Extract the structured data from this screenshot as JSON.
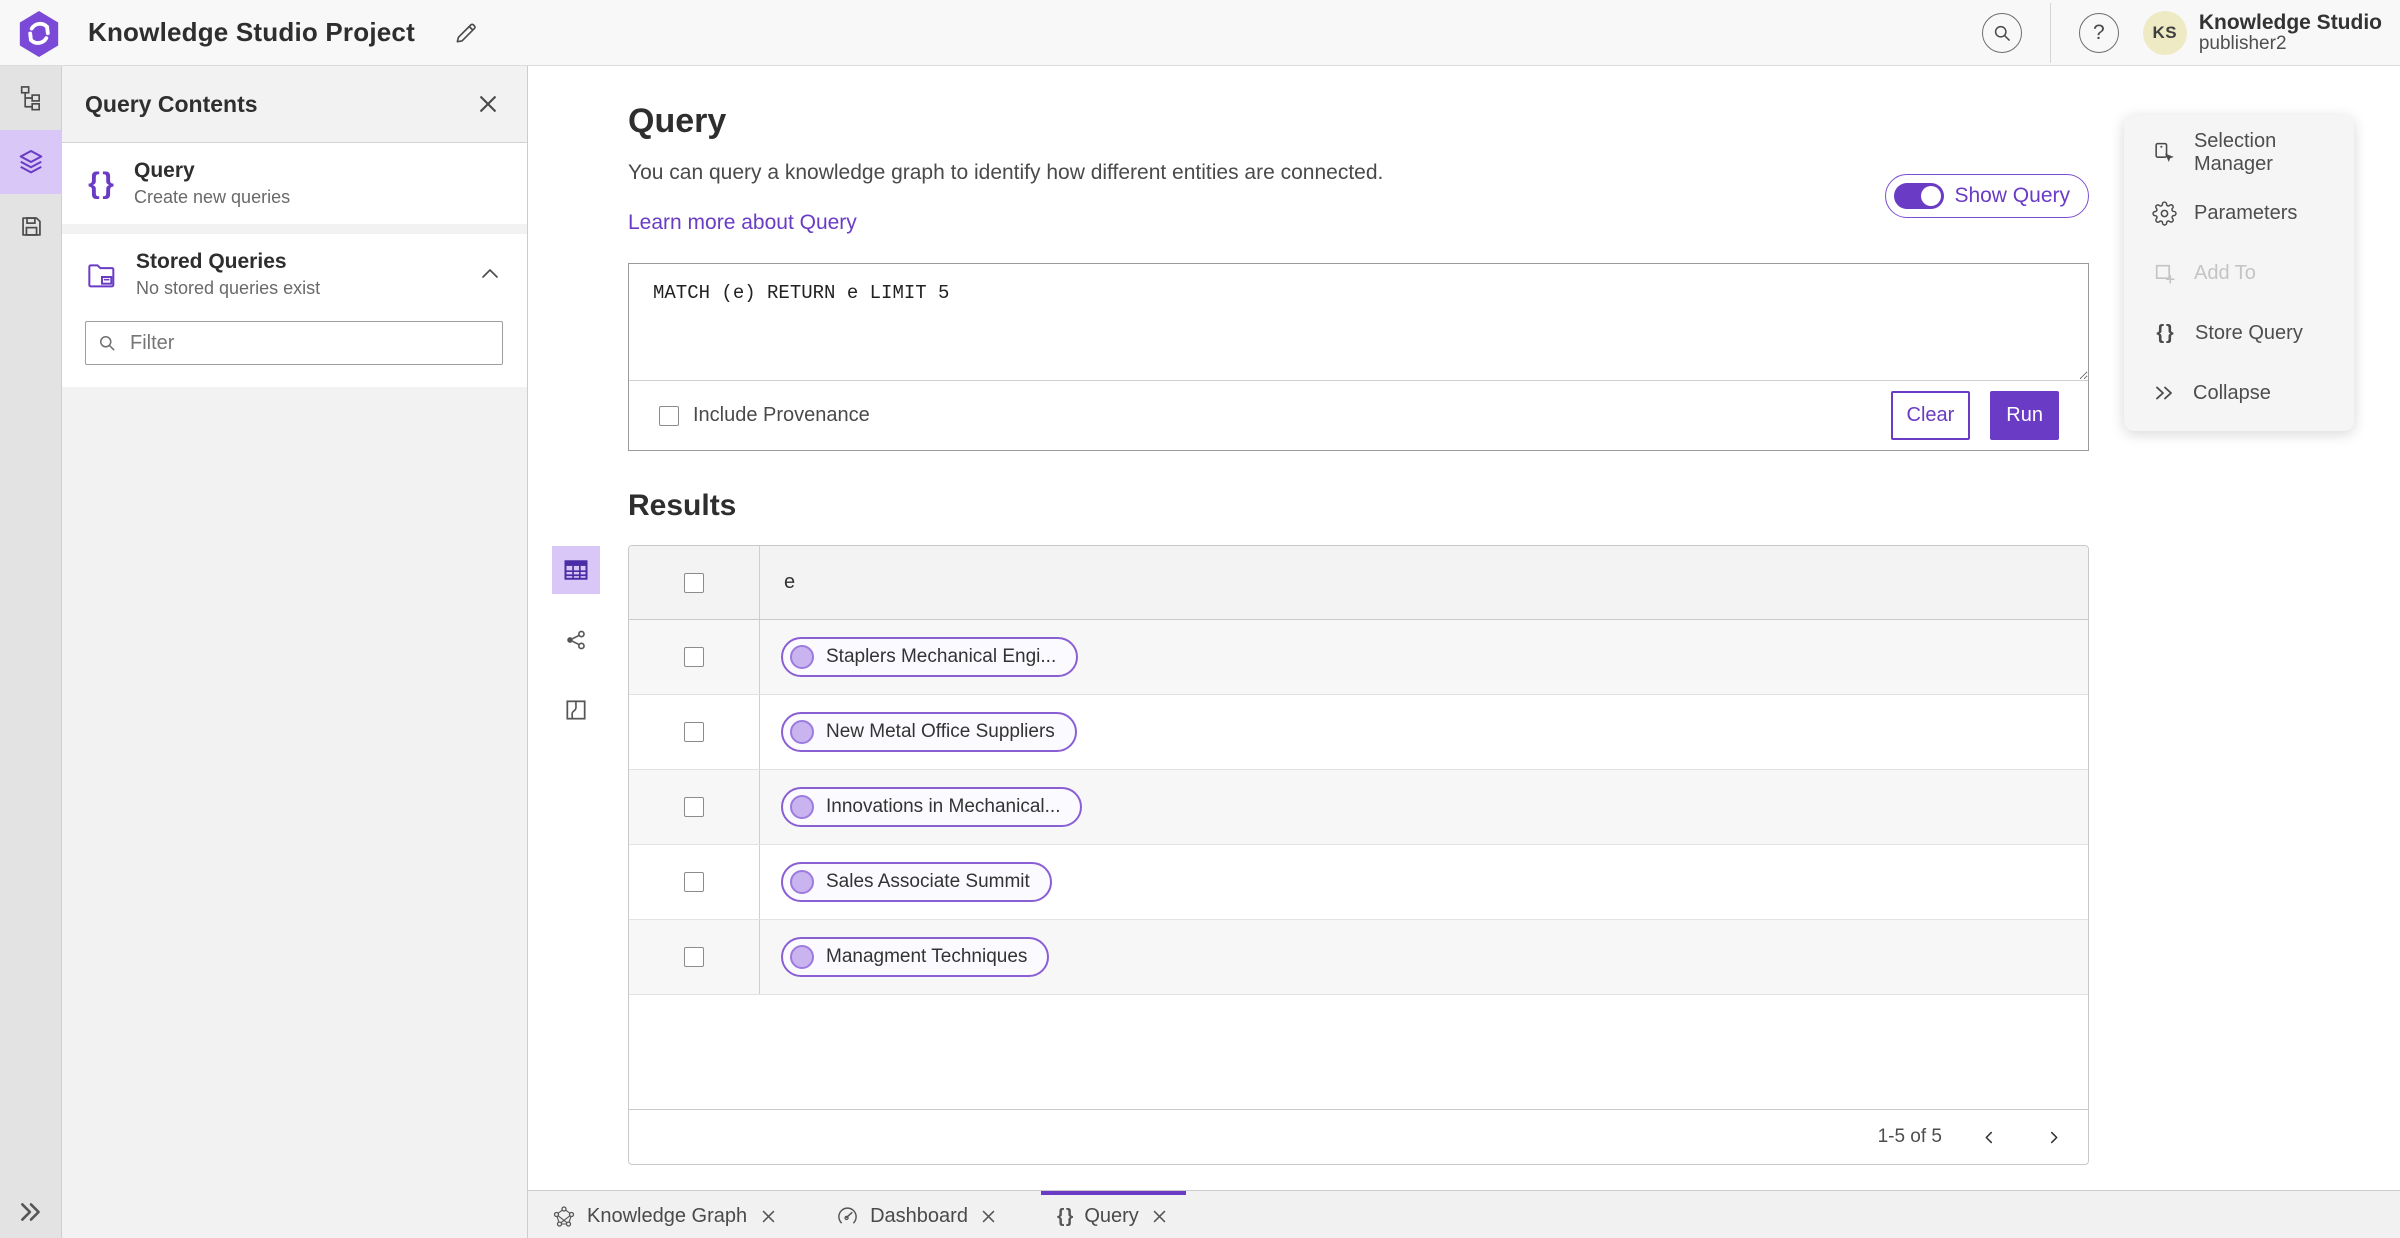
{
  "app": {
    "title": "Knowledge Studio Project",
    "account_name": "Knowledge Studio",
    "account_user": "publisher2",
    "avatar_initials": "KS"
  },
  "colors": {
    "accent": "#6a3cc5",
    "accent_light": "#d9c8f7",
    "pill_border": "#8a5fd4",
    "pill_bg": "#fbfaff",
    "avatar_bg": "#eeeac4"
  },
  "panel": {
    "title": "Query Contents",
    "query_item": {
      "title": "Query",
      "subtitle": "Create new queries"
    },
    "stored_item": {
      "title": "Stored Queries",
      "subtitle": "No stored queries exist"
    },
    "filter_placeholder": "Filter"
  },
  "query": {
    "heading": "Query",
    "description": "You can query a knowledge graph to identify how different entities are connected.",
    "learn_more": "Learn more about Query",
    "show_query": "Show Query",
    "code": "MATCH (e) RETURN e LIMIT 5",
    "include_provenance": "Include Provenance",
    "clear": "Clear",
    "run": "Run"
  },
  "results": {
    "heading": "Results",
    "column": "e",
    "rows": [
      "Staplers Mechanical Engi...",
      "New Metal Office Suppliers",
      "Innovations in Mechanical...",
      "Sales Associate Summit",
      "Managment Techniques"
    ],
    "pagination": "1-5 of 5"
  },
  "actions": {
    "items": [
      {
        "label": "Selection Manager",
        "icon": "selection-manager-icon",
        "disabled": false
      },
      {
        "label": "Parameters",
        "icon": "parameters-gear-icon",
        "disabled": false
      },
      {
        "label": "Add To",
        "icon": "add-to-icon",
        "disabled": true
      },
      {
        "label": "Store Query",
        "icon": "store-query-braces-icon",
        "disabled": false
      },
      {
        "label": "Collapse",
        "icon": "collapse-chevrons-icon",
        "disabled": false
      }
    ]
  },
  "tabs": [
    {
      "label": "Knowledge Graph",
      "icon": "knowledge-graph-icon",
      "active": false
    },
    {
      "label": "Dashboard",
      "icon": "dashboard-gauge-icon",
      "active": false
    },
    {
      "label": "Query",
      "icon": "query-braces-icon",
      "active": true
    }
  ]
}
